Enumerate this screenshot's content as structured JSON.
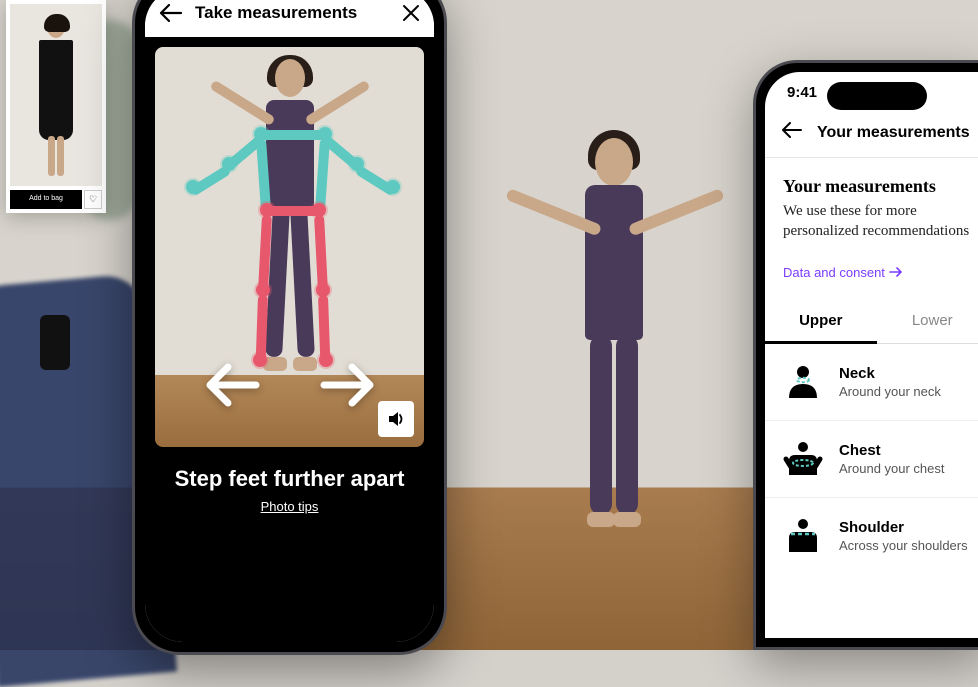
{
  "product": {
    "add_to_bag": "Add to bag"
  },
  "center_phone": {
    "header_title": "Take measurements",
    "instruction": "Step feet further apart",
    "photo_tips": "Photo tips"
  },
  "right_phone": {
    "time": "9:41",
    "header_title": "Your measurements",
    "heading": "Your measurements",
    "subheading": "We use these for more personalized recommendations",
    "consent_link": "Data and consent",
    "tabs": {
      "upper": "Upper",
      "lower": "Lower"
    },
    "measurements": [
      {
        "title": "Neck",
        "desc": "Around your neck"
      },
      {
        "title": "Chest",
        "desc": "Around your chest"
      },
      {
        "title": "Shoulder",
        "desc": "Across your shoulders"
      }
    ]
  },
  "colors": {
    "teal": "#5dc9c0",
    "pink": "#e8586d",
    "purple": "#7a3cff"
  }
}
